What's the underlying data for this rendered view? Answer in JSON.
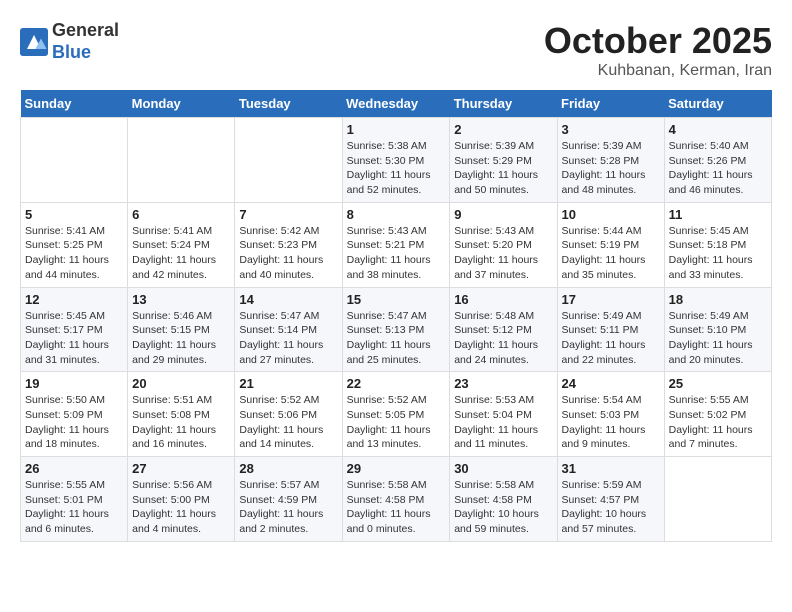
{
  "logo": {
    "general": "General",
    "blue": "Blue"
  },
  "header": {
    "month": "October 2025",
    "location": "Kuhbanan, Kerman, Iran"
  },
  "days_of_week": [
    "Sunday",
    "Monday",
    "Tuesday",
    "Wednesday",
    "Thursday",
    "Friday",
    "Saturday"
  ],
  "weeks": [
    [
      {
        "day": "",
        "info": ""
      },
      {
        "day": "",
        "info": ""
      },
      {
        "day": "",
        "info": ""
      },
      {
        "day": "1",
        "info": "Sunrise: 5:38 AM\nSunset: 5:30 PM\nDaylight: 11 hours and 52 minutes."
      },
      {
        "day": "2",
        "info": "Sunrise: 5:39 AM\nSunset: 5:29 PM\nDaylight: 11 hours and 50 minutes."
      },
      {
        "day": "3",
        "info": "Sunrise: 5:39 AM\nSunset: 5:28 PM\nDaylight: 11 hours and 48 minutes."
      },
      {
        "day": "4",
        "info": "Sunrise: 5:40 AM\nSunset: 5:26 PM\nDaylight: 11 hours and 46 minutes."
      }
    ],
    [
      {
        "day": "5",
        "info": "Sunrise: 5:41 AM\nSunset: 5:25 PM\nDaylight: 11 hours and 44 minutes."
      },
      {
        "day": "6",
        "info": "Sunrise: 5:41 AM\nSunset: 5:24 PM\nDaylight: 11 hours and 42 minutes."
      },
      {
        "day": "7",
        "info": "Sunrise: 5:42 AM\nSunset: 5:23 PM\nDaylight: 11 hours and 40 minutes."
      },
      {
        "day": "8",
        "info": "Sunrise: 5:43 AM\nSunset: 5:21 PM\nDaylight: 11 hours and 38 minutes."
      },
      {
        "day": "9",
        "info": "Sunrise: 5:43 AM\nSunset: 5:20 PM\nDaylight: 11 hours and 37 minutes."
      },
      {
        "day": "10",
        "info": "Sunrise: 5:44 AM\nSunset: 5:19 PM\nDaylight: 11 hours and 35 minutes."
      },
      {
        "day": "11",
        "info": "Sunrise: 5:45 AM\nSunset: 5:18 PM\nDaylight: 11 hours and 33 minutes."
      }
    ],
    [
      {
        "day": "12",
        "info": "Sunrise: 5:45 AM\nSunset: 5:17 PM\nDaylight: 11 hours and 31 minutes."
      },
      {
        "day": "13",
        "info": "Sunrise: 5:46 AM\nSunset: 5:15 PM\nDaylight: 11 hours and 29 minutes."
      },
      {
        "day": "14",
        "info": "Sunrise: 5:47 AM\nSunset: 5:14 PM\nDaylight: 11 hours and 27 minutes."
      },
      {
        "day": "15",
        "info": "Sunrise: 5:47 AM\nSunset: 5:13 PM\nDaylight: 11 hours and 25 minutes."
      },
      {
        "day": "16",
        "info": "Sunrise: 5:48 AM\nSunset: 5:12 PM\nDaylight: 11 hours and 24 minutes."
      },
      {
        "day": "17",
        "info": "Sunrise: 5:49 AM\nSunset: 5:11 PM\nDaylight: 11 hours and 22 minutes."
      },
      {
        "day": "18",
        "info": "Sunrise: 5:49 AM\nSunset: 5:10 PM\nDaylight: 11 hours and 20 minutes."
      }
    ],
    [
      {
        "day": "19",
        "info": "Sunrise: 5:50 AM\nSunset: 5:09 PM\nDaylight: 11 hours and 18 minutes."
      },
      {
        "day": "20",
        "info": "Sunrise: 5:51 AM\nSunset: 5:08 PM\nDaylight: 11 hours and 16 minutes."
      },
      {
        "day": "21",
        "info": "Sunrise: 5:52 AM\nSunset: 5:06 PM\nDaylight: 11 hours and 14 minutes."
      },
      {
        "day": "22",
        "info": "Sunrise: 5:52 AM\nSunset: 5:05 PM\nDaylight: 11 hours and 13 minutes."
      },
      {
        "day": "23",
        "info": "Sunrise: 5:53 AM\nSunset: 5:04 PM\nDaylight: 11 hours and 11 minutes."
      },
      {
        "day": "24",
        "info": "Sunrise: 5:54 AM\nSunset: 5:03 PM\nDaylight: 11 hours and 9 minutes."
      },
      {
        "day": "25",
        "info": "Sunrise: 5:55 AM\nSunset: 5:02 PM\nDaylight: 11 hours and 7 minutes."
      }
    ],
    [
      {
        "day": "26",
        "info": "Sunrise: 5:55 AM\nSunset: 5:01 PM\nDaylight: 11 hours and 6 minutes."
      },
      {
        "day": "27",
        "info": "Sunrise: 5:56 AM\nSunset: 5:00 PM\nDaylight: 11 hours and 4 minutes."
      },
      {
        "day": "28",
        "info": "Sunrise: 5:57 AM\nSunset: 4:59 PM\nDaylight: 11 hours and 2 minutes."
      },
      {
        "day": "29",
        "info": "Sunrise: 5:58 AM\nSunset: 4:58 PM\nDaylight: 11 hours and 0 minutes."
      },
      {
        "day": "30",
        "info": "Sunrise: 5:58 AM\nSunset: 4:58 PM\nDaylight: 10 hours and 59 minutes."
      },
      {
        "day": "31",
        "info": "Sunrise: 5:59 AM\nSunset: 4:57 PM\nDaylight: 10 hours and 57 minutes."
      },
      {
        "day": "",
        "info": ""
      }
    ]
  ]
}
